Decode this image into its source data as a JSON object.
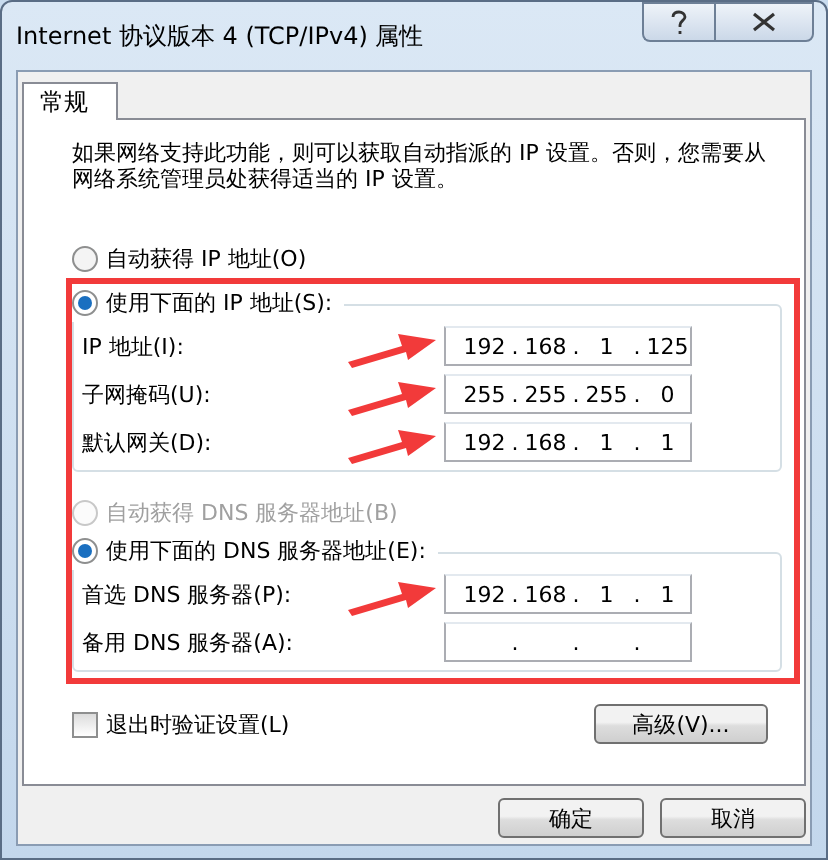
{
  "window": {
    "title": "Internet 协议版本 4 (TCP/IPv4) 属性"
  },
  "tabs": [
    {
      "label": "常规",
      "selected": true
    }
  ],
  "description": "如果网络支持此功能，则可以获取自动指派的 IP 设置。否则，您需要从网络系统管理员处获得适当的 IP 设置。",
  "ip_section": {
    "auto": {
      "label": "自动获得 IP 地址(O)",
      "selected": false,
      "disabled": false
    },
    "manual": {
      "label": "使用下面的 IP 地址(S):",
      "selected": true,
      "disabled": false
    },
    "fields": [
      {
        "label": "IP 地址(I):",
        "octets": [
          "192",
          "168",
          "1",
          "125"
        ],
        "dots": [
          ".",
          ".",
          "."
        ]
      },
      {
        "label": "子网掩码(U):",
        "octets": [
          "255",
          "255",
          "255",
          "0"
        ],
        "dots": [
          ".",
          ".",
          "."
        ]
      },
      {
        "label": "默认网关(D):",
        "octets": [
          "192",
          "168",
          "1",
          "1"
        ],
        "dots": [
          ".",
          ".",
          "."
        ]
      }
    ]
  },
  "dns_section": {
    "auto": {
      "label": "自动获得 DNS 服务器地址(B)",
      "selected": false,
      "disabled": true
    },
    "manual": {
      "label": "使用下面的 DNS 服务器地址(E):",
      "selected": true,
      "disabled": false
    },
    "fields": [
      {
        "label": "首选 DNS 服务器(P):",
        "octets": [
          "192",
          "168",
          "1",
          "1"
        ],
        "dots": [
          ".",
          ".",
          "."
        ]
      },
      {
        "label": "备用 DNS 服务器(A):",
        "dots": [
          ".",
          ".",
          "."
        ]
      }
    ]
  },
  "validate_checkbox": {
    "label": "退出时验证设置(L)",
    "checked": false
  },
  "advanced_button": "高级(V)...",
  "buttons": [
    "确定",
    "取消"
  ]
}
